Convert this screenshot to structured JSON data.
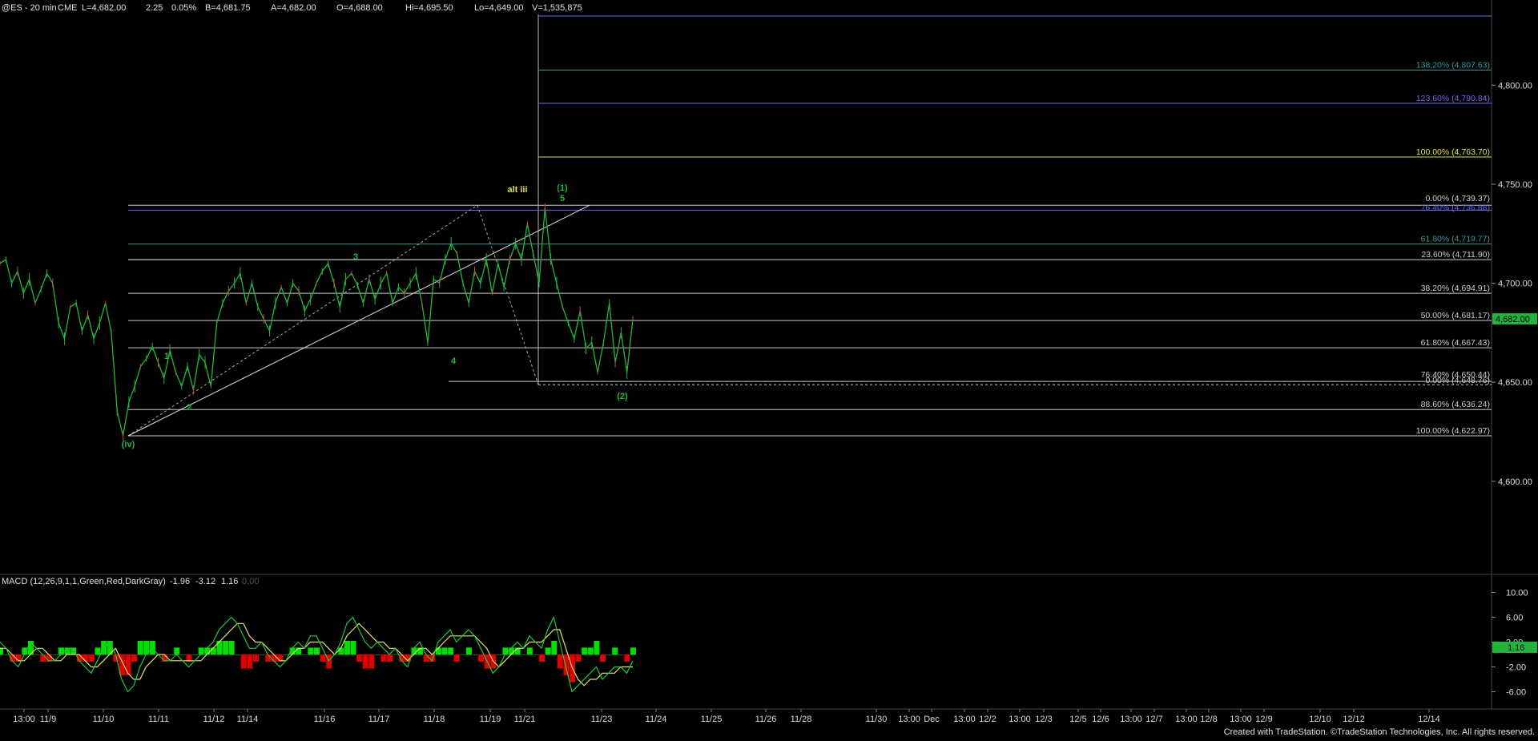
{
  "header": {
    "symbol": "@ES - 20 min",
    "exchange": "CME",
    "last": "L=4,682.00",
    "change": "2.25",
    "change_pct": "0.05%",
    "bid": "B=4,681.75",
    "ask": "A=4,682.00",
    "open": "O=4,688.00",
    "high": "Hi=4,695.50",
    "low": "Lo=4,649.00",
    "volume": "V=1,535,875"
  },
  "footer": {
    "credit": "Created with TradeStation. ©TradeStation Technologies, Inc. All rights reserved."
  },
  "colors": {
    "background": "#000000",
    "price": "#1fb83a",
    "macd_line": "#1ec83c",
    "signal_line": "#e8e070",
    "hist_pos": "#00e000",
    "hist_neg": "#e00000",
    "grid": "#1a1a1a",
    "current_price_box": "#22b33c"
  },
  "chart_data": [
    {
      "type": "line",
      "title": "",
      "series": [
        {
          "name": "",
          "values": []
        }
      ],
      "ylim": [
        4553,
        4843
      ],
      "y_ticks": [
        "4,800.00",
        "4,750.00",
        "4,700.00",
        "4,650.00",
        "4,600.00"
      ],
      "x_ticks": [
        "13:00",
        "11/9",
        "11/10",
        "11/11",
        "11/12",
        "11/14",
        "11/16",
        "11/17",
        "11/18",
        "11/19",
        "11/21",
        "11/23",
        "11/24",
        "11/25",
        "11/26",
        "11/28",
        "11/30",
        "13:00",
        "Dec",
        "13:00",
        "12/2",
        "13:00",
        "12/3",
        "12/5",
        "12/6",
        "13:00",
        "12/7",
        "13:00",
        "12/8",
        "13:00",
        "12/9",
        "12/10",
        "12/12",
        "12/14"
      ],
      "current_price": "4,682.00",
      "price_path": [
        [
          4710,
          4712,
          4700,
          4706,
          4695,
          4702,
          4690,
          4697,
          4705,
          4700,
          4680,
          4672,
          4688,
          4690,
          4676,
          4684,
          4672,
          4680,
          4690,
          4675,
          4635,
          4623,
          4640,
          4648,
          4658,
          4662,
          4668,
          4660,
          4652,
          4666,
          4655,
          4648,
          4658,
          4646,
          4664,
          4660,
          4648,
          4680,
          4690,
          4696,
          4700,
          4705,
          4690,
          4700,
          4688,
          4682,
          4676,
          4690,
          4698,
          4690,
          4700,
          4696,
          4686,
          4692,
          4700,
          4706,
          4710,
          4700,
          4688,
          4702,
          4705,
          4699,
          4690,
          4702,
          4692,
          4700,
          4705,
          4690,
          4698,
          4695,
          4700,
          4705,
          4690,
          4670,
          4702,
          4700,
          4712,
          4720,
          4715,
          4700,
          4690,
          4706,
          4700,
          4712,
          4695,
          4710,
          4698,
          4712,
          4720,
          4712,
          4730,
          4715,
          4700,
          4738,
          4712,
          4700,
          4688,
          4680,
          4672,
          4686,
          4667,
          4670,
          4655,
          4670,
          4690,
          4660,
          4675,
          4655,
          4682
        ]
      ],
      "levels_upper": [
        {
          "label": "138.20% (4,807.63)",
          "value": 4807.63,
          "color": "#3a9a9a"
        },
        {
          "label": "123.60% (4,790.84)",
          "value": 4790.84,
          "color": "#6a6af0"
        },
        {
          "label": "100.00% (4,763.70)",
          "value": 4763.7,
          "color": "#e0e040"
        },
        {
          "label": "0.00% (4,739.37)",
          "value": 4739.37,
          "color": "#cccccc"
        },
        {
          "label": "76.40% (4,736.88)",
          "value": 4736.88,
          "color": "#6a6af0"
        },
        {
          "label": "61.80% (4,719.77)",
          "value": 4719.77,
          "color": "#3a9a9a"
        },
        {
          "label": "23.60% (4,711.90)",
          "value": 4711.9,
          "color": "#cccccc"
        },
        {
          "label": "38.20% (4,694.91)",
          "value": 4694.91,
          "color": "#cccccc"
        },
        {
          "label": "50.00% (4,681.17)",
          "value": 4681.17,
          "color": "#cccccc"
        },
        {
          "label": "61.80% (4,667.43)",
          "value": 4667.43,
          "color": "#cccccc"
        },
        {
          "label": "76.40% (4,650.44)",
          "value": 4650.44,
          "color": "#cccccc"
        },
        {
          "label": "0.00% (4,648.76)",
          "value": 4648.76,
          "color": "#cccccc"
        },
        {
          "label": "88.60% (4,636.24)",
          "value": 4636.24,
          "color": "#cccccc"
        },
        {
          "label": "100.00% (4,622.97)",
          "value": 4622.97,
          "color": "#cccccc"
        }
      ],
      "wave_labels": [
        {
          "text": "(iv)",
          "color": "#1fb83a"
        },
        {
          "text": "1",
          "color": "#1fb83a"
        },
        {
          "text": "2",
          "color": "#1fb83a"
        },
        {
          "text": "3",
          "color": "#1fb83a"
        },
        {
          "text": "4",
          "color": "#1fb83a"
        },
        {
          "text": "alt iii",
          "color": "#e0e040"
        },
        {
          "text": "(1)",
          "color": "#1fb83a"
        },
        {
          "text": "5",
          "color": "#1fb83a"
        },
        {
          "text": "(2)",
          "color": "#1fb83a"
        }
      ]
    },
    {
      "type": "area",
      "title": "MACD (12,26,9,1,1,Green,Red,DarkGray)",
      "readout": [
        "-1.96",
        "-3.12",
        "1.16",
        "0.00"
      ],
      "ylim": [
        -8,
        12
      ],
      "y_ticks": [
        "10.00",
        "6.00",
        "2.00",
        "-2.00",
        "-6.00"
      ],
      "current_value": "1.16",
      "macd": [
        2,
        1,
        -1,
        -2,
        0,
        2,
        1,
        0,
        -1,
        -1,
        0,
        1,
        1,
        -1,
        -2,
        -3,
        -1,
        1,
        2,
        0,
        -4,
        -6,
        -5,
        -2,
        0,
        1,
        0,
        -1,
        -1,
        0,
        -1,
        -2,
        -1,
        0,
        1,
        2,
        4,
        5,
        6,
        5,
        3,
        1,
        1,
        2,
        0,
        -1,
        -2,
        -1,
        1,
        2,
        1,
        3,
        3,
        1,
        -1,
        0,
        2,
        5,
        6,
        4,
        2,
        1,
        2,
        1,
        0,
        1,
        -1,
        -2,
        1,
        2,
        0,
        -1,
        2,
        3,
        4,
        2,
        3,
        4,
        3,
        1,
        -1,
        -3,
        -2,
        0,
        1,
        2,
        1,
        3,
        2,
        1,
        4,
        6,
        2,
        -2,
        -6,
        -5,
        -4,
        -3,
        -2,
        -4,
        -3,
        -2,
        -2,
        -3,
        -1
      ],
      "signal": [
        1,
        1,
        0,
        -1,
        -1,
        0,
        1,
        1,
        0,
        -1,
        -1,
        0,
        0,
        0,
        -1,
        -2,
        -2,
        -1,
        0,
        1,
        -1,
        -3,
        -4,
        -4,
        -2,
        -1,
        0,
        0,
        -1,
        -1,
        -1,
        -1,
        -1,
        -1,
        0,
        1,
        2,
        3,
        4,
        5,
        5,
        3,
        2,
        2,
        1,
        0,
        -1,
        -1,
        0,
        1,
        1,
        2,
        2,
        2,
        1,
        0,
        1,
        3,
        4,
        5,
        4,
        3,
        2,
        2,
        1,
        1,
        0,
        -1,
        0,
        1,
        1,
        0,
        1,
        2,
        3,
        3,
        3,
        3,
        3,
        2,
        1,
        -1,
        -2,
        -1,
        0,
        1,
        1,
        2,
        2,
        2,
        3,
        4,
        4,
        1,
        -2,
        -4,
        -5,
        -4,
        -4,
        -3,
        -3,
        -3,
        -2,
        -2,
        -2
      ]
    }
  ]
}
